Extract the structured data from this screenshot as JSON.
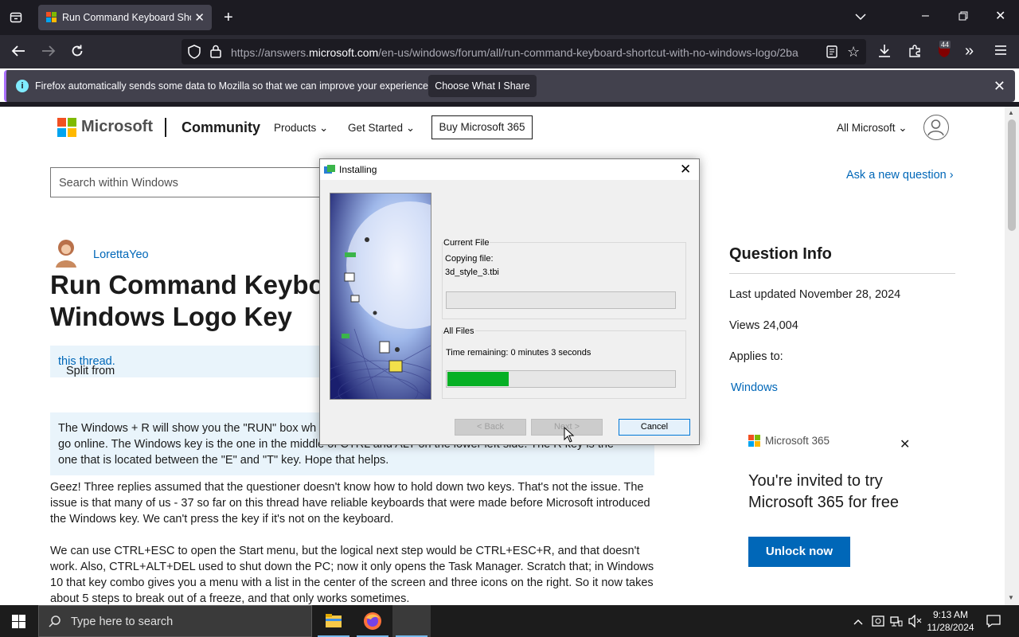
{
  "browser": {
    "tab_title": "Run Command Keyboard Shortcut with No Windows Logo Key",
    "url_prefix": "https://answers.",
    "url_domain": "microsoft.com",
    "url_path": "/en-us/windows/forum/all/run-command-keyboard-shortcut-with-no-windows-logo/2ba",
    "badge_count": "44",
    "infobar_message": "Firefox automatically sends some data to Mozilla so that we can improve your experience.",
    "infobar_button": "Choose What I Share"
  },
  "site": {
    "brand": "Microsoft",
    "section": "Community",
    "nav": [
      "Products",
      "Get Started"
    ],
    "buy_button": "Buy Microsoft 365",
    "all_microsoft": "All Microsoft",
    "search_placeholder": "Search within Windows",
    "ask_link": "Ask a new question"
  },
  "question": {
    "author": "LorettaYeo",
    "title": "Run Command Keyboard Shortcut with No Windows Logo Key",
    "title_line1": "Run Command Keybo",
    "title_line2": "Windows Logo Key",
    "split_prefix": "Split from ",
    "split_link": "this thread.",
    "quote": "The Windows + R will show you the \"RUN\" box wh... go online. The Windows key is the one in the middle of CTRL and ALT on the lower left side. The R key is the one that is located between the \"E\" and \"T\" key. Hope that helps.",
    "quote_line1": "The Windows + R will show you the \"RUN\" box wh",
    "quote_line2": "go online. The Windows key is the one in the middle of CTRL and ALT on the lower left side. The R key is the",
    "quote_line3": "one that is located between the \"E\" and \"T\" key. Hope that helps.",
    "para1": "Geez!  Three replies assumed that the questioner doesn't know how to hold down two keys.  That's not the issue. The issue is that many of us - 37 so far on this thread have reliable keyboards that were made before Microsoft introduced the Windows key.  We can't press the key if it's not on the keyboard.",
    "para2": "We can use CTRL+ESC to open the Start menu, but the logical next step would be CTRL+ESC+R, and that doesn't work.  Also, CTRL+ALT+DEL used to shut down the PC; now it only opens the Task Manager.  Scratch that; in Windows 10 that key combo gives you a menu with a list in the center of the screen and three icons on the right. So it now takes about 5 steps to break out of a freeze, and that only works sometimes."
  },
  "question_info": {
    "heading": "Question Info",
    "last_updated": "Last updated November 28, 2024",
    "views": "Views 24,004",
    "applies_to": "Applies to:",
    "applies_link": "Windows"
  },
  "ad": {
    "brand": "Microsoft 365",
    "text": "You're invited to try Microsoft 365 for free",
    "button": "Unlock now"
  },
  "dialog": {
    "title": "Installing",
    "current_file_label": "Current File",
    "copying_label": "Copying file:",
    "file_name": "3d_style_3.tbi",
    "current_progress": 0,
    "all_files_label": "All Files",
    "time_remaining": "Time remaining: 0 minutes 3 seconds",
    "all_progress": 0.27,
    "back_button": "< Back",
    "next_button": "Next >",
    "cancel_button": "Cancel"
  },
  "taskbar": {
    "search_placeholder": "Type here to search",
    "time": "9:13 AM",
    "date": "11/28/2024"
  },
  "colors": {
    "accent_link": "#0067b8",
    "progress_green": "#06b025",
    "infobar_stripe": "#a970ff"
  }
}
